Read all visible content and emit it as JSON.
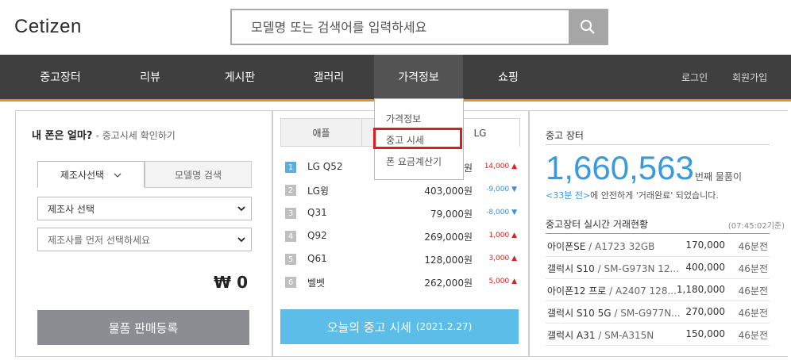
{
  "header": {
    "logo": "Cetizen",
    "search_placeholder": "모델명 또는 검색어를 입력하세요"
  },
  "nav": {
    "items": [
      "중고장터",
      "리뷰",
      "게시판",
      "갤러리",
      "가격정보",
      "쇼핑"
    ],
    "active": "가격정보",
    "login": "로그인",
    "signup": "회원가입"
  },
  "dropdown": {
    "items": [
      "가격정보",
      "중고 시세",
      "폰 요금계산기"
    ],
    "highlighted": "중고 시세"
  },
  "left_panel": {
    "title": "내 폰은 얼마?",
    "subtitle": "- 중고시세 확인하기",
    "tab_manufacturer": "제조사선택",
    "tab_model": "모델명 검색",
    "select_manufacturer": "제조사 선택",
    "select_model": "제조사를 먼저 선택하세요",
    "price": "₩ 0",
    "register_button": "물품 판매등록"
  },
  "middle_panel": {
    "tabs": [
      "애플",
      "LG"
    ],
    "rankings": [
      {
        "rank": "1",
        "name": "LG Q52",
        "price": "원",
        "change": "14,000",
        "dir": "up"
      },
      {
        "rank": "2",
        "name": "LG윙",
        "price": "403,000원",
        "change": "-9,000",
        "dir": "down"
      },
      {
        "rank": "3",
        "name": "Q31",
        "price": "79,000원",
        "change": "-8,000",
        "dir": "down"
      },
      {
        "rank": "4",
        "name": "Q92",
        "price": "269,000원",
        "change": "1,000",
        "dir": "up"
      },
      {
        "rank": "5",
        "name": "Q61",
        "price": "128,000원",
        "change": "3,000",
        "dir": "up"
      },
      {
        "rank": "6",
        "name": "벨벳",
        "price": "262,000원",
        "change": "5,000",
        "dir": "up"
      }
    ],
    "today_button": "오늘의 중고 시세",
    "today_date": "(2021.2.27)"
  },
  "right_panel": {
    "title": "중고 장터",
    "count": "1,660,563",
    "count_suffix": "번째 물품이",
    "desc_time": "<33분 전>",
    "desc_rest": "에 안전하게 '거래완료' 되었습니다.",
    "realtime_title": "중고장터 실시간 거래현황",
    "realtime_time": "(07:45:02기준)",
    "transactions": [
      {
        "name": "아이폰SE",
        "model": "/ A1723 32GB",
        "price": "170,000",
        "time": "46분전"
      },
      {
        "name": "갤럭시 S10",
        "model": "/ SM-G973N 12...",
        "price": "400,000",
        "time": "46분전"
      },
      {
        "name": "아이폰12 프로",
        "model": "/ A2407 128...",
        "price": "1,180,000",
        "time": "46분전"
      },
      {
        "name": "갤럭시 S10 5G",
        "model": "/ SM-G977N...",
        "price": "270,000",
        "time": "46분전"
      },
      {
        "name": "갤럭시 A31",
        "model": "/ SM-A315N",
        "price": "150,000",
        "time": "46분전"
      }
    ]
  },
  "colors": {
    "accent_orange": "#ee8a1e",
    "nav_bg": "#3f3f3f",
    "blue": "#3b9ad9",
    "highlight_red": "#e01b1b"
  }
}
